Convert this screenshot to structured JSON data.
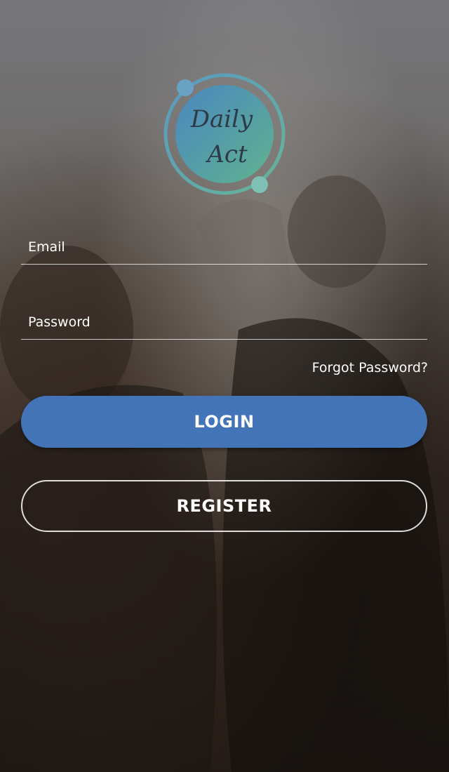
{
  "logo": {
    "line1": "Daily",
    "line2": "Act",
    "ring_color": "#5aa0a8",
    "gradient_start": "#4a86c0",
    "gradient_end": "#5fb38f"
  },
  "login_form": {
    "email_placeholder": "Email",
    "password_placeholder": "Password",
    "forgot_password_label": "Forgot Password?",
    "login_button_label": "LOGIN",
    "register_button_label": "REGISTER"
  },
  "colors": {
    "primary": "#4274b7",
    "text": "#ffffff"
  }
}
